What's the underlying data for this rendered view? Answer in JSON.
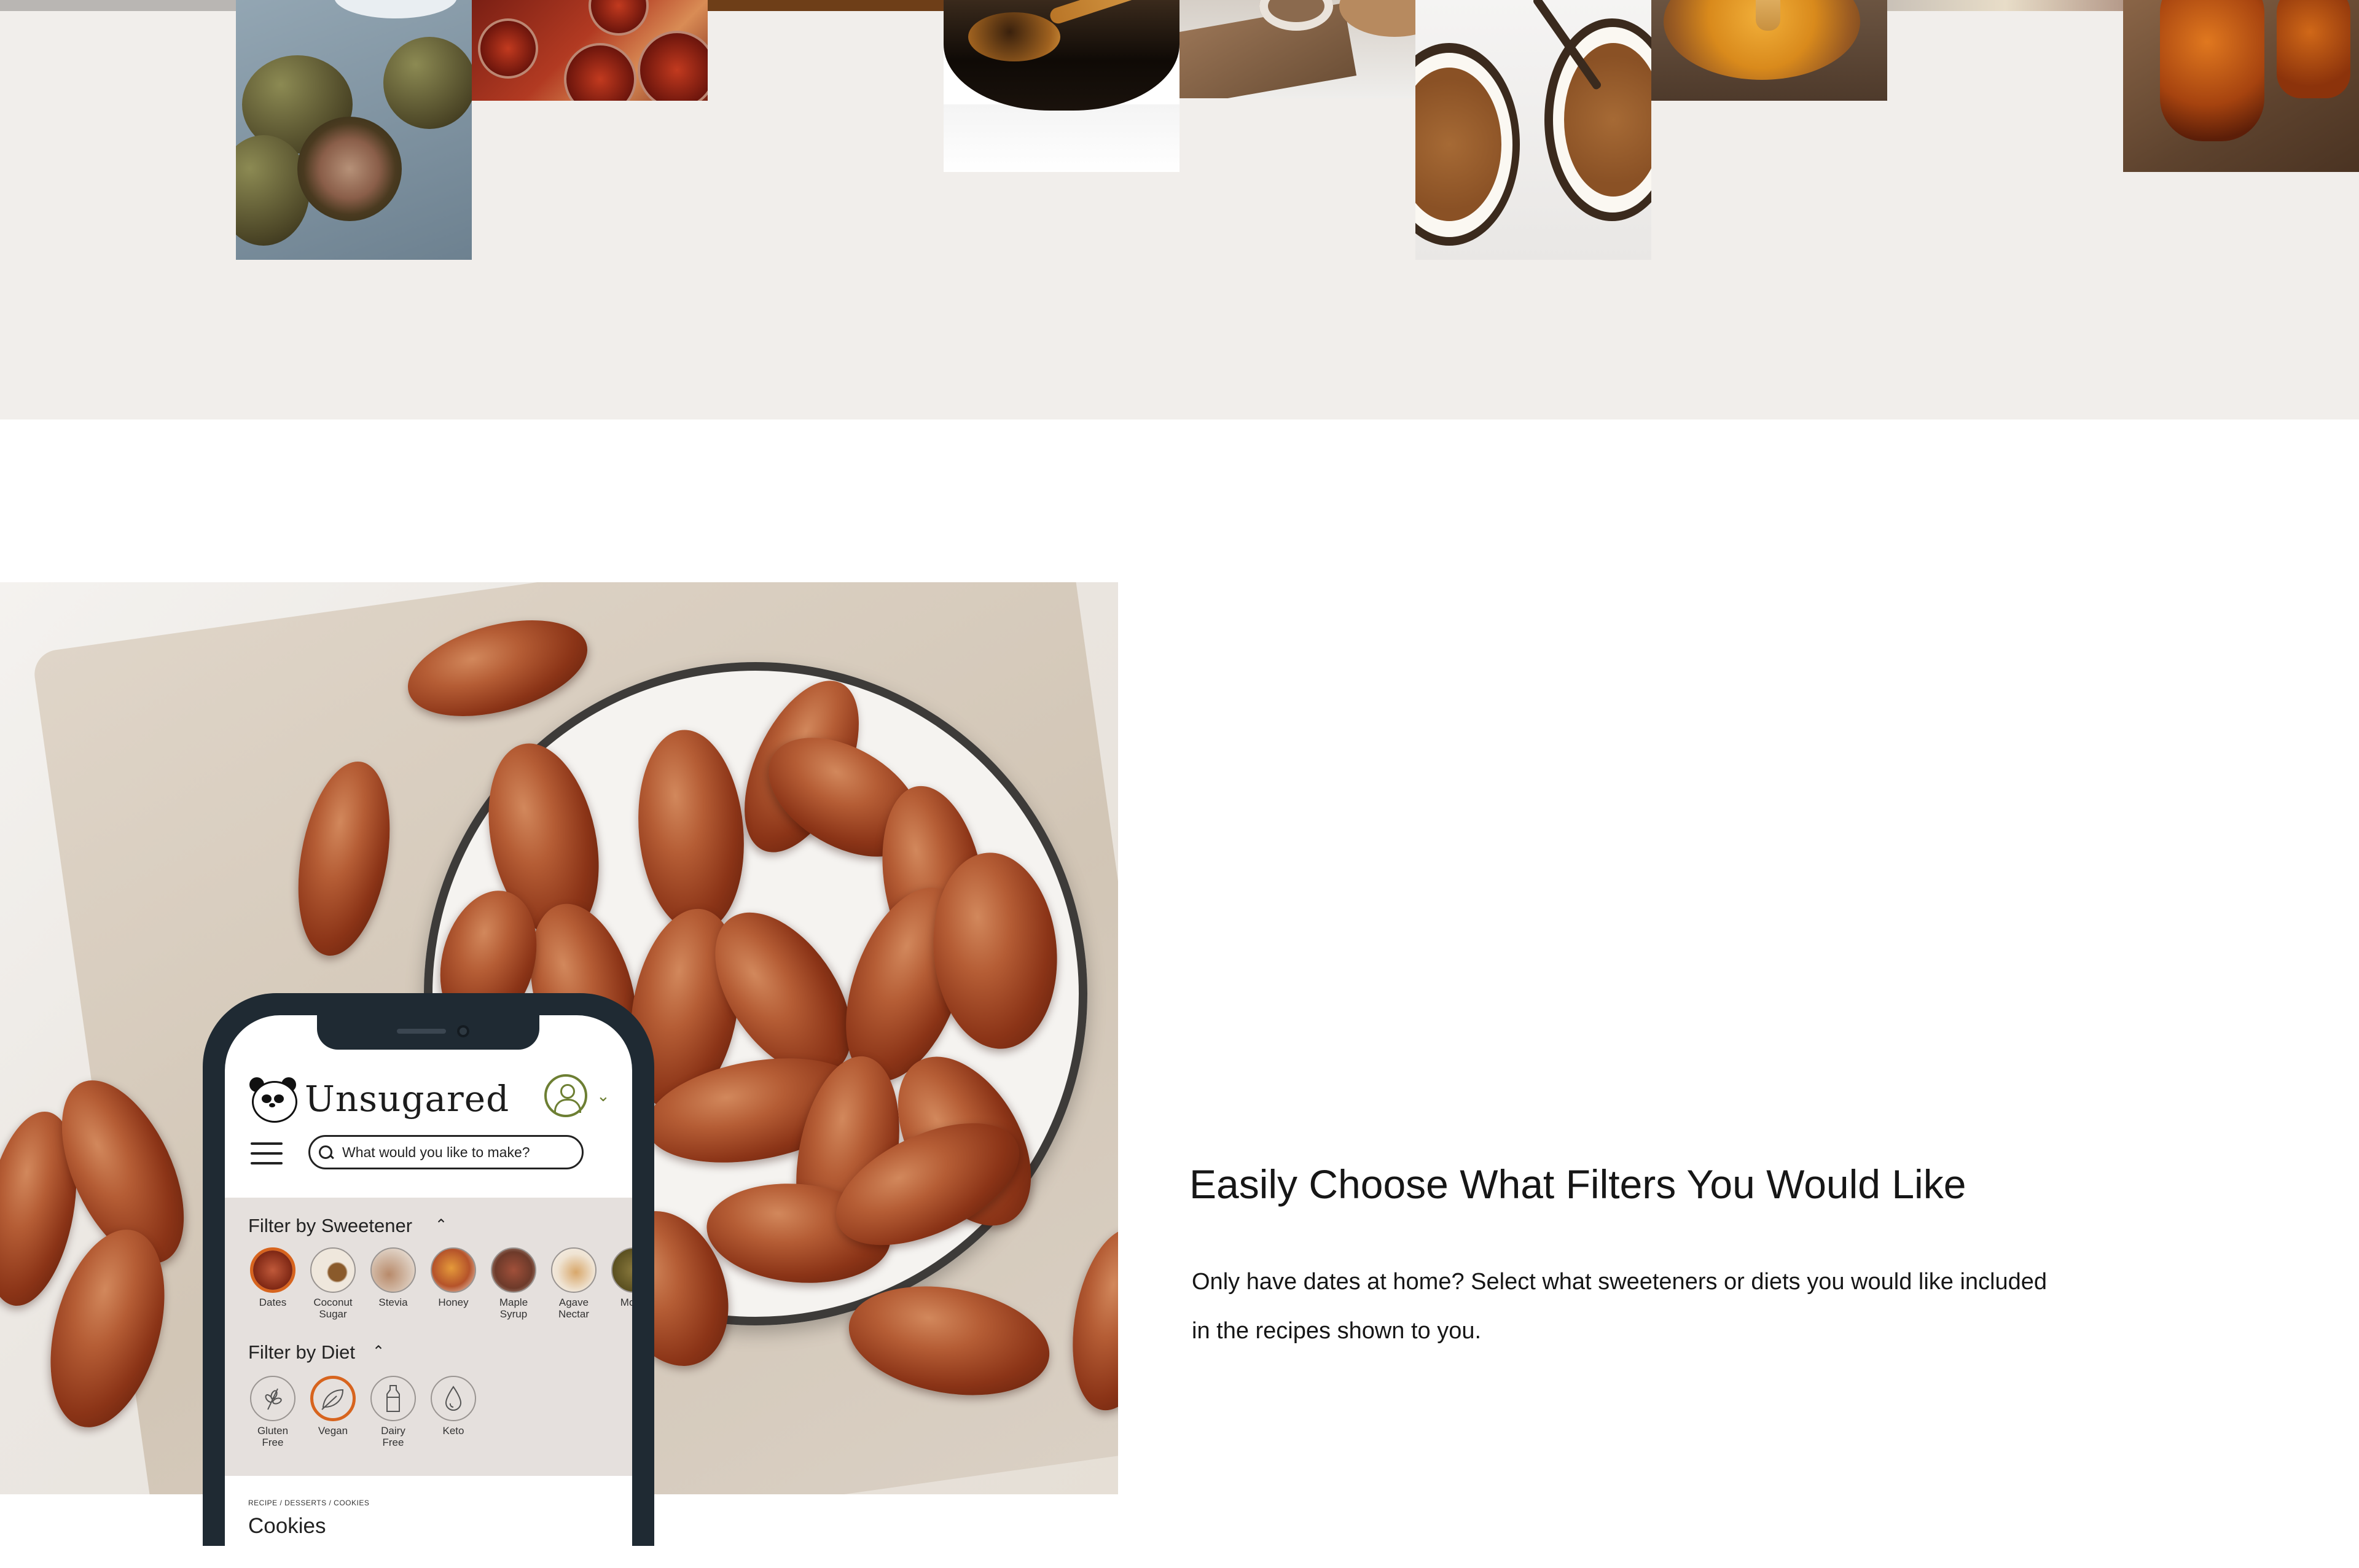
{
  "sweetener_strip": {
    "images": [
      "monk-fruit-photo",
      "jam-jars-photo",
      "molasses-spoon-photo",
      "sugar-board-photo",
      "coconut-sugar-photo",
      "honey-bowl-photo",
      "maple-syrup-bottle-photo"
    ]
  },
  "phone": {
    "brand": "Unsugared",
    "search_placeholder": "What would you like to make?",
    "sweetener_filter_title": "Filter by Sweetener",
    "sweeteners": [
      {
        "label": "Dates"
      },
      {
        "label": "Coconut Sugar"
      },
      {
        "label": "Stevia"
      },
      {
        "label": "Honey"
      },
      {
        "label": "Maple Syrup"
      },
      {
        "label": "Agave Nectar"
      },
      {
        "label": "Mo Fr"
      }
    ],
    "diet_filter_title": "Filter by Diet",
    "diets": [
      {
        "label": "Gluten Free",
        "icon": "wheat-icon"
      },
      {
        "label": "Vegan",
        "icon": "leaf-icon"
      },
      {
        "label": "Dairy Free",
        "icon": "milk-bottle-icon"
      },
      {
        "label": "Keto",
        "icon": "drop-icon"
      }
    ],
    "breadcrumb": "RECIPE / DESSERTS / COOKIES",
    "page_title": "Cookies"
  },
  "feature": {
    "heading": "Easily Choose What Filters You Would Like",
    "body": "Only have dates at home? Select what sweeteners or diets you would like included in the recipes shown to you."
  },
  "colors": {
    "strip_bg": "#f1eeeb",
    "filter_panel_bg": "#e5e0dd",
    "selected_accent": "#d7641e",
    "account_icon": "#6d7f33",
    "phone_frame": "#1f2a33"
  }
}
